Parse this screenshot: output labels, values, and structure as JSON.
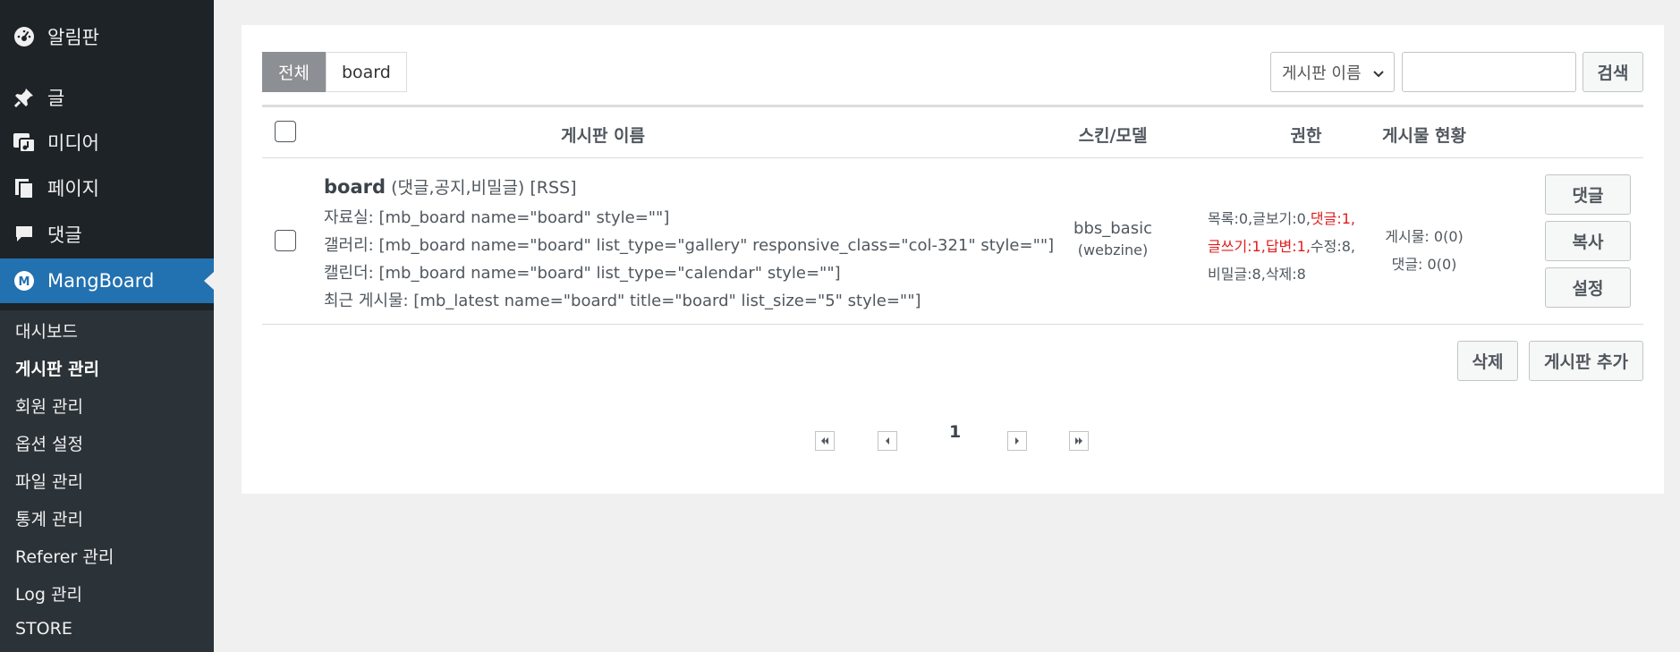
{
  "sidebar": {
    "top_items": [
      {
        "label": "알림판",
        "icon": "dashboard-icon"
      },
      {
        "label": "글",
        "icon": "pin-icon"
      },
      {
        "label": "미디어",
        "icon": "media-icon"
      },
      {
        "label": "페이지",
        "icon": "pages-icon"
      },
      {
        "label": "댓글",
        "icon": "comments-icon"
      },
      {
        "label": "MangBoard",
        "icon": "mangboard-icon",
        "active": true
      }
    ],
    "sub_items": [
      {
        "label": "대시보드"
      },
      {
        "label": "게시판 관리",
        "current": true
      },
      {
        "label": "회원 관리"
      },
      {
        "label": "옵션 설정"
      },
      {
        "label": "파일 관리"
      },
      {
        "label": "통계 관리"
      },
      {
        "label": "Referer 관리"
      },
      {
        "label": "Log 관리"
      },
      {
        "label": "STORE"
      }
    ]
  },
  "filters": {
    "tabs": [
      {
        "label": "전체",
        "selected": true
      },
      {
        "label": "board"
      }
    ],
    "search_field_selected": "게시판 이름",
    "search_value": "",
    "search_button": "검색"
  },
  "table": {
    "headers": {
      "name": "게시판 이름",
      "skin": "스킨/모델",
      "perm": "권한",
      "status": "게시물 현황"
    },
    "rows": [
      {
        "name": "board",
        "options": "(댓글,공지,비밀글)",
        "rss": "[RSS]",
        "shortcodes": [
          "자료실: [mb_board name=\"board\" style=\"\"]",
          "갤러리: [mb_board name=\"board\" list_type=\"gallery\" responsive_class=\"col-321\" style=\"\"]",
          "캘린더: [mb_board name=\"board\" list_type=\"calendar\" style=\"\"]",
          "최근 게시물: [mb_latest name=\"board\" title=\"board\" list_size=\"5\" style=\"\"]"
        ],
        "skin": "bbs_basic",
        "model": "(webzine)",
        "perm": {
          "p1": "목록:0,글보기:0,",
          "p2": "댓글:1,",
          "p3": "글쓰기:1,답변:1,",
          "p4": "수정:8,",
          "p5": "비밀글:8,삭제:8"
        },
        "posts": "게시물: 0(0)",
        "comments": "댓글: 0(0)",
        "actions": [
          "댓글",
          "복사",
          "설정"
        ]
      }
    ]
  },
  "bottom_actions": {
    "delete": "삭제",
    "add": "게시판 추가"
  },
  "pagination": {
    "current": "1"
  },
  "colors": {
    "sidebar_bg": "#1d2327",
    "accent": "#2271b1",
    "permission_red": "#e01b1b"
  }
}
